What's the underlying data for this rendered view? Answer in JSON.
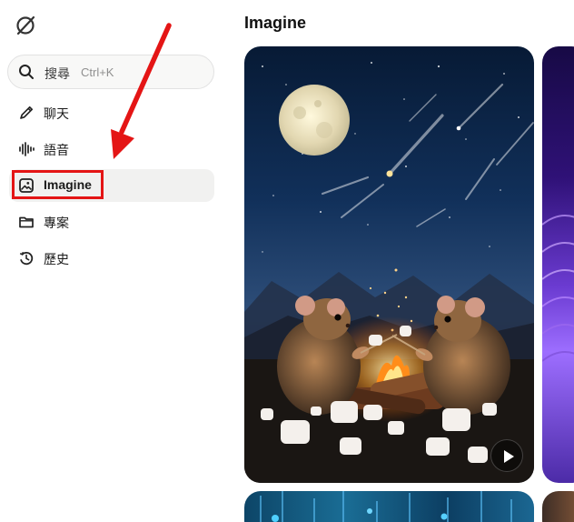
{
  "sidebar": {
    "search": {
      "label": "搜尋",
      "shortcut": "Ctrl+K"
    },
    "items": [
      {
        "label": "聊天",
        "icon": "edit-icon",
        "active": false
      },
      {
        "label": "語音",
        "icon": "audio-wave-icon",
        "active": false
      },
      {
        "label": "Imagine",
        "icon": "image-icon",
        "active": true
      },
      {
        "label": "專案",
        "icon": "folder-icon",
        "active": false
      },
      {
        "label": "歷史",
        "icon": "history-icon",
        "active": false
      }
    ]
  },
  "main": {
    "title": "Imagine"
  },
  "annotation": {
    "highlight_color": "#e41515"
  },
  "colors": {
    "accent_red": "#e41515",
    "sidebar_active_bg": "#f1f1f0"
  }
}
